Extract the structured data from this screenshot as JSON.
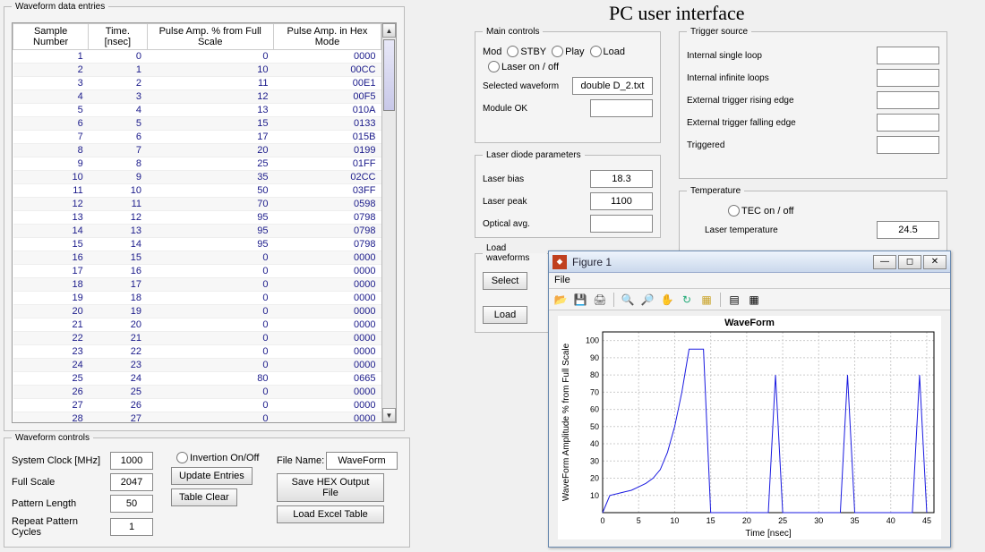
{
  "title": "PC user interface",
  "waveform_entries": {
    "legend": "Waveform data entries",
    "headers": [
      "Sample Number",
      "Time. [nsec]",
      "Pulse Amp. % from Full Scale",
      "Pulse Amp. in Hex Mode"
    ],
    "rows": [
      [
        1,
        0,
        0,
        "0000"
      ],
      [
        2,
        1,
        10,
        "00CC"
      ],
      [
        3,
        2,
        11,
        "00E1"
      ],
      [
        4,
        3,
        12,
        "00F5"
      ],
      [
        5,
        4,
        13,
        "010A"
      ],
      [
        6,
        5,
        15,
        "0133"
      ],
      [
        7,
        6,
        17,
        "015B"
      ],
      [
        8,
        7,
        20,
        "0199"
      ],
      [
        9,
        8,
        25,
        "01FF"
      ],
      [
        10,
        9,
        35,
        "02CC"
      ],
      [
        11,
        10,
        50,
        "03FF"
      ],
      [
        12,
        11,
        70,
        "0598"
      ],
      [
        13,
        12,
        95,
        "0798"
      ],
      [
        14,
        13,
        95,
        "0798"
      ],
      [
        15,
        14,
        95,
        "0798"
      ],
      [
        16,
        15,
        0,
        "0000"
      ],
      [
        17,
        16,
        0,
        "0000"
      ],
      [
        18,
        17,
        0,
        "0000"
      ],
      [
        19,
        18,
        0,
        "0000"
      ],
      [
        20,
        19,
        0,
        "0000"
      ],
      [
        21,
        20,
        0,
        "0000"
      ],
      [
        22,
        21,
        0,
        "0000"
      ],
      [
        23,
        22,
        0,
        "0000"
      ],
      [
        24,
        23,
        0,
        "0000"
      ],
      [
        25,
        24,
        80,
        "0665"
      ],
      [
        26,
        25,
        0,
        "0000"
      ],
      [
        27,
        26,
        0,
        "0000"
      ],
      [
        28,
        27,
        0,
        "0000"
      ]
    ]
  },
  "waveform_controls": {
    "legend": "Waveform controls",
    "system_clock_label": "System Clock [MHz]",
    "system_clock": "1000",
    "full_scale_label": "Full Scale",
    "full_scale": "2047",
    "pattern_length_label": "Pattern Length",
    "pattern_length": "50",
    "repeat_cycles_label": "Repeat Pattern Cycles",
    "repeat_cycles": "1",
    "invertion_label": "Invertion On/Off",
    "file_name_label": "File Name:",
    "file_name": "WaveForm",
    "update_entries": "Update Entries",
    "table_clear": "Table Clear",
    "save_hex": "Save HEX Output File",
    "load_excel": "Load Excel Table"
  },
  "main_controls": {
    "legend": "Main controls",
    "mod": "Mod",
    "stby": "STBY",
    "play": "Play",
    "load": "Load",
    "laser_on_off": "Laser on / off",
    "selected_waveform_label": "Selected waveform",
    "selected_waveform": "double D_2.txt",
    "module_ok_label": "Module OK",
    "module_ok": ""
  },
  "laser_diode": {
    "legend": "Laser diode parameters",
    "bias_label": "Laser bias",
    "bias": "18.3",
    "peak_label": "Laser peak",
    "peak": "1100",
    "avg_label": "Optical avg.",
    "avg": ""
  },
  "load_waveforms": {
    "legend": "Load waveforms",
    "select": "Select",
    "load": "Load"
  },
  "trigger_source": {
    "legend": "Trigger source",
    "items": [
      {
        "label": "Internal single loop",
        "value": ""
      },
      {
        "label": "Internal infinite loops",
        "value": ""
      },
      {
        "label": "External trigger rising edge",
        "value": ""
      },
      {
        "label": "External trigger falling edge",
        "value": ""
      },
      {
        "label": "Triggered",
        "value": ""
      }
    ]
  },
  "temperature": {
    "legend": "Temperature",
    "tec_label": "TEC on / off",
    "laser_temp_label": "Laser temperature",
    "laser_temp": "24.5"
  },
  "figure": {
    "title": "Figure 1",
    "menu_file": "File",
    "plot_title": "WaveForm",
    "ylabel": "WaveForm Amplitude % from Full Scale",
    "xlabel": "Time [nsec]"
  },
  "chart_data": {
    "type": "line",
    "title": "WaveForm",
    "xlabel": "Time [nsec]",
    "ylabel": "WaveForm Amplitude % from Full Scale",
    "xlim": [
      0,
      46
    ],
    "ylim": [
      0,
      105
    ],
    "xticks": [
      0,
      5,
      10,
      15,
      20,
      25,
      30,
      35,
      40,
      45
    ],
    "yticks": [
      10,
      20,
      30,
      40,
      50,
      60,
      70,
      80,
      90,
      100
    ],
    "x": [
      0,
      1,
      2,
      3,
      4,
      5,
      6,
      7,
      8,
      9,
      10,
      11,
      12,
      13,
      14,
      15,
      16,
      17,
      18,
      19,
      20,
      21,
      22,
      23,
      24,
      25,
      26,
      27,
      28,
      29,
      30,
      31,
      32,
      33,
      34,
      35,
      36,
      37,
      38,
      39,
      40,
      41,
      42,
      43,
      44,
      45
    ],
    "y": [
      0,
      10,
      11,
      12,
      13,
      15,
      17,
      20,
      25,
      35,
      50,
      70,
      95,
      95,
      95,
      0,
      0,
      0,
      0,
      0,
      0,
      0,
      0,
      0,
      80,
      0,
      0,
      0,
      0,
      0,
      0,
      0,
      0,
      0,
      80,
      0,
      0,
      0,
      0,
      0,
      0,
      0,
      0,
      0,
      80,
      0
    ]
  }
}
